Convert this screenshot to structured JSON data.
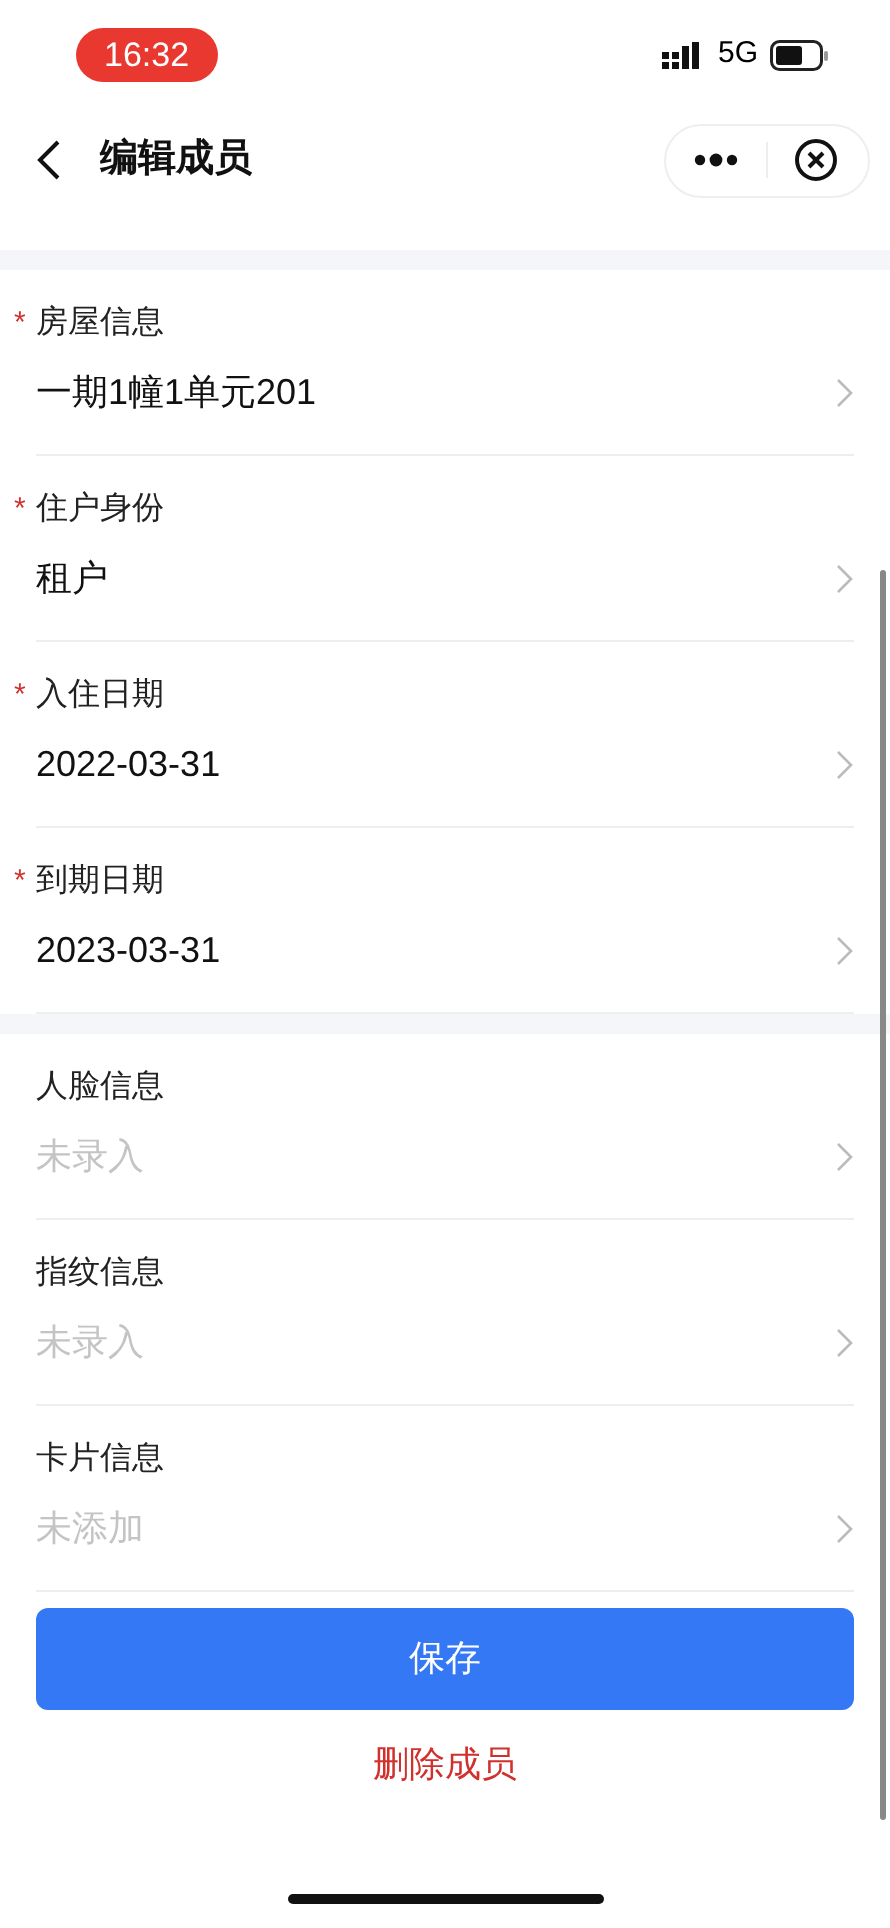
{
  "status_bar": {
    "time": "16:32",
    "network": "5G"
  },
  "nav": {
    "title": "编辑成员"
  },
  "sections": [
    {
      "fields": [
        {
          "mark": "*",
          "label": "房屋信息",
          "value": "一期1幢1单元201"
        },
        {
          "mark": "*",
          "label": "住户身份",
          "value": "租户"
        },
        {
          "mark": "*",
          "label": "入住日期",
          "value": "2022-03-31"
        },
        {
          "mark": "*",
          "label": "到期日期",
          "value": "2023-03-31"
        }
      ]
    },
    {
      "fields": [
        {
          "label": "人脸信息",
          "placeholder": "未录入"
        },
        {
          "label": "指纹信息",
          "placeholder": "未录入"
        },
        {
          "label": "卡片信息",
          "placeholder": "未添加"
        }
      ]
    }
  ],
  "save_button": "保存",
  "delete_link": "删除成员"
}
